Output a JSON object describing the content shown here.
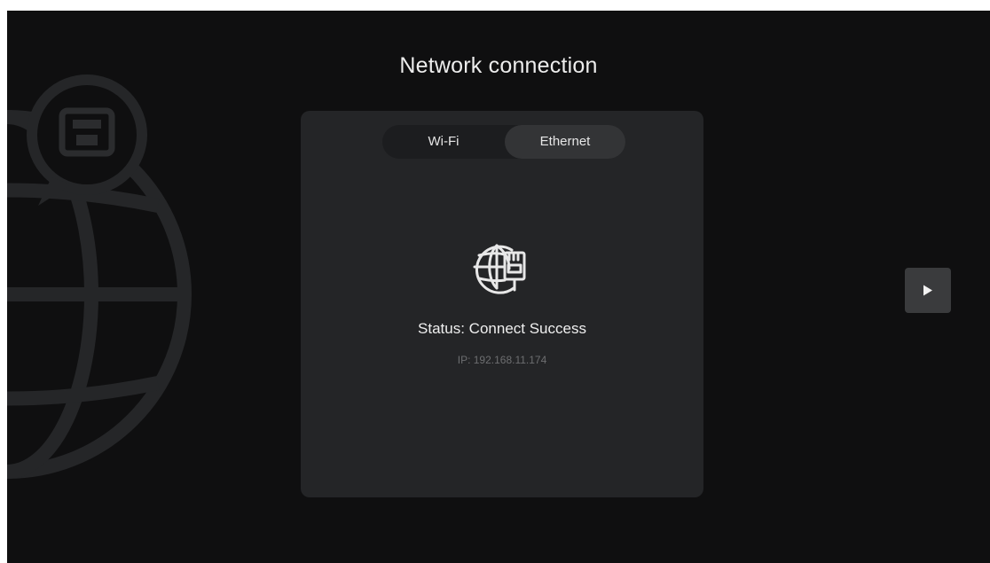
{
  "page": {
    "title": "Network connection"
  },
  "tabs": [
    {
      "label": "Wi-Fi",
      "selected": false
    },
    {
      "label": "Ethernet",
      "selected": true
    }
  ],
  "status": {
    "text": "Status: Connect Success",
    "ip": "IP: 192.168.11.174"
  },
  "icons": {
    "main": "globe-ethernet-icon",
    "background": "globe-ethernet-background",
    "next": "play-arrow-icon"
  },
  "colors": {
    "background": "#0f0f10",
    "card": "#242527",
    "tab_selected": "#333436",
    "text_primary": "#efefef",
    "text_secondary": "#6d6e70"
  }
}
